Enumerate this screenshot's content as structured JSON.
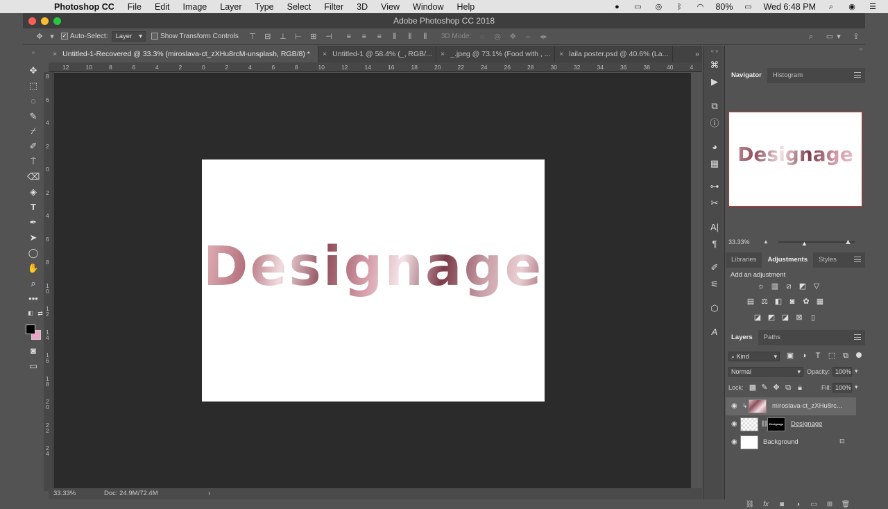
{
  "menubar": {
    "app_name": "Photoshop CC",
    "items": [
      "File",
      "Edit",
      "Image",
      "Layer",
      "Type",
      "Select",
      "Filter",
      "3D",
      "View",
      "Window",
      "Help"
    ],
    "battery": "80%",
    "clock": "Wed 6:48 PM"
  },
  "window": {
    "title": "Adobe Photoshop CC 2018"
  },
  "options_bar": {
    "auto_select_label": "Auto-Select:",
    "auto_select_value": "Layer",
    "transform_label": "Show Transform Controls",
    "mode_label": "3D Mode:"
  },
  "tabs": [
    {
      "label": "Untitled-1-Recovered @ 33.3% (miroslava-ct_zXHu8rcM-unsplash, RGB/8) *"
    },
    {
      "label": "Untitled-1 @ 58.4% (_, RGB/..."
    },
    {
      "label": "_.jpeg @ 73.1% (Food with , ..."
    },
    {
      "label": "laila poster.psd @ 40.6% (La..."
    }
  ],
  "ruler_h": [
    "12",
    "10",
    "8",
    "6",
    "4",
    "2",
    "0",
    "2",
    "4",
    "6",
    "8",
    "10",
    "12",
    "14",
    "16",
    "18",
    "20",
    "22",
    "24",
    "26",
    "28",
    "30",
    "32",
    "34",
    "36",
    "38",
    "40",
    "4"
  ],
  "ruler_v": [
    "8",
    "6",
    "4",
    "2",
    "0",
    "2",
    "4",
    "6",
    "8",
    "1\n0",
    "1\n2",
    "1\n4",
    "1\n6",
    "1\n8",
    "2\n0",
    "2\n2",
    "2\n4"
  ],
  "canvas": {
    "artwork_text": "Designage"
  },
  "status": {
    "zoom": "33.33%",
    "doc": "Doc: 24.9M/72.4M"
  },
  "navigator": {
    "tabs": [
      "Navigator",
      "Histogram"
    ],
    "zoom": "33.33%"
  },
  "adjustments": {
    "tabs": [
      "Libraries",
      "Adjustments",
      "Styles"
    ],
    "heading": "Add an adjustment"
  },
  "layers": {
    "tabs": [
      "Layers",
      "Paths"
    ],
    "filter_kind": "Kind",
    "blend_mode": "Normal",
    "opacity_label": "Opacity:",
    "opacity": "100%",
    "lock_label": "Lock:",
    "fill_label": "Fill:",
    "fill": "100%",
    "rows": [
      {
        "name": "miroslava-ct_zXHu8rc..."
      },
      {
        "name": "Designage",
        "mask_text": "Designage"
      },
      {
        "name": "Background"
      }
    ]
  },
  "colors": {
    "foreground": "#000000",
    "background": "#e8a4c4",
    "nav_frame": "#c83232"
  }
}
